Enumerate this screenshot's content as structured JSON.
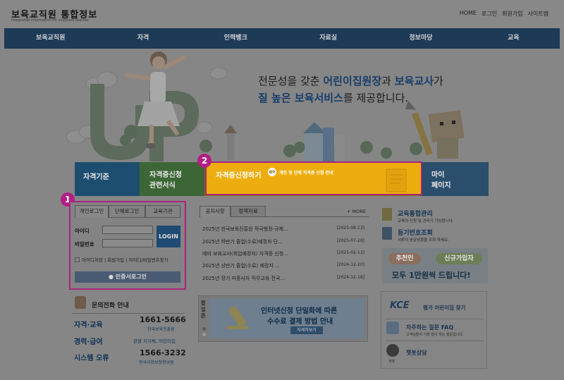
{
  "header": {
    "logo_title": "보육교직원 통합정보",
    "logo_sub": "Integrated Information for childcare teacher",
    "util_links": [
      "HOME",
      "로그인",
      "회원가입",
      "사이트맵"
    ]
  },
  "gnb": [
    "보육교직원",
    "자격",
    "인력뱅크",
    "자료실",
    "정보마당",
    "교육"
  ],
  "hero": {
    "line1_prefix": "전문성을 갖춘 ",
    "line1_hl1": "어린이집원장",
    "line1_mid": "과 ",
    "line1_hl2": "보육교사",
    "line1_suffix": "가",
    "line2_hl": "질 높은 보육서비스",
    "line2_suffix": "를 제공합니다."
  },
  "tiles": {
    "qualification": "자격기준",
    "forms_1": "자격증신청",
    "forms_2": "관련서식",
    "cert_apply": "자격증신청하기",
    "go_badge": "go",
    "cert_desc": "개인 및 단체 자격증 신청 안내",
    "my_1": "마이",
    "my_2": "페이지"
  },
  "markers": {
    "one": "1",
    "two": "2"
  },
  "login": {
    "tabs": [
      "개인로그인",
      "단체로그인",
      "교육기관"
    ],
    "id_label": "아이디",
    "pw_label": "비밀번호",
    "login_button": "LOGIN",
    "save_id": "아이디저장",
    "signup": "회원가입",
    "find": "아이디/비밀번호찾기",
    "cert_login": "인증서로그인"
  },
  "contact": {
    "title": "문의전화 안내",
    "rows": [
      {
        "label": "자격·교육",
        "phone": "1661-5666",
        "org": "한국보육진흥원"
      },
      {
        "label": "경력·급여",
        "phone": "",
        "org": "관할 지자체, 어린이집"
      },
      {
        "label": "시스템 오류",
        "phone": "1566-3232",
        "org": "한국사회보장정보원"
      }
    ]
  },
  "notice": {
    "tabs": [
      "공지사항",
      "정책자료"
    ],
    "more": "+ MORE",
    "items": [
      {
        "title": "2025년 한국보육진흥원 적극행정-규제...",
        "date": "[2025-08-13]"
      },
      {
        "title": "2025년 하반기 졸업(수료)예정자 단...",
        "date": "[2025-07-28]"
      },
      {
        "title": "예비 보육교사(취업예정자) 자격증 신청...",
        "date": "[2025-02-13]"
      },
      {
        "title": "2025년 상반기 졸업(수료) 예정자 ...",
        "date": "[2024-12-20]"
      },
      {
        "title": "2025년 장기 미종사자 직무교육 전국...",
        "date": "[2024-12-18]"
      }
    ]
  },
  "banner": {
    "side": "팝업존",
    "line1": "인터넷신청 단일화에 따른",
    "line2": "수수료 결제 방법 안내",
    "button": "자세히보기"
  },
  "right": {
    "edu_title": "교육통합관리",
    "edu_sub": "교육의 신청 및 관리가 가능합니다.",
    "reg_title": "등기번호조회",
    "reg_sub": "서류의 송달상황을 조회 하세요.",
    "promo_recommender": "추천인",
    "promo_newuser": "신규가입자",
    "promo_line2": "모두 1만원씩 드립니다!",
    "kce_logo": "KCE",
    "kce_text": "평가 어린이집 찾기",
    "faq_title": "자주하는 질문 FAQ",
    "faq_sub": "고객님들이 가장 많이 하는 질문입니다.",
    "chatbot": "챗봇상담",
    "chatbot_sub": "챗봇"
  }
}
